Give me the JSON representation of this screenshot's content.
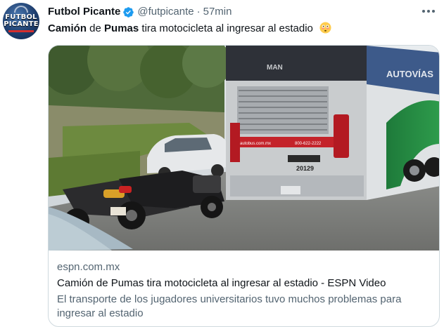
{
  "account": {
    "display_name": "Futbol Picante",
    "handle": "@futpicante",
    "separator": "·",
    "timestamp": "57min",
    "avatar_text_line1": "FUTBOL",
    "avatar_text_line2": "PICANTE",
    "verified_color": "#1d9bf0"
  },
  "tweet": {
    "word1": "Camión",
    "word2": " de ",
    "word3": "Pumas",
    "word4": " tira motocicleta al ingresar al estadio"
  },
  "card": {
    "domain": "espn.com.mx",
    "title": "Camión de Pumas tira motocicleta al ingresar al estadio - ESPN Video",
    "description": "El transporte de los jugadores universitarios tuvo muchos problemas para ingresar al estadio",
    "image": {
      "bus_brand": "MAN",
      "bus_phone": "800-622-2222",
      "bus_website": "autobus.com.mx",
      "bus_number": "20129"
    }
  },
  "colors": {
    "text_primary": "#0f1419",
    "text_secondary": "#536471",
    "border": "#cfd9de"
  },
  "icons": {
    "verified": "verified-badge-icon",
    "more": "more-options-icon",
    "emoji": "flushed-face-emoji"
  }
}
